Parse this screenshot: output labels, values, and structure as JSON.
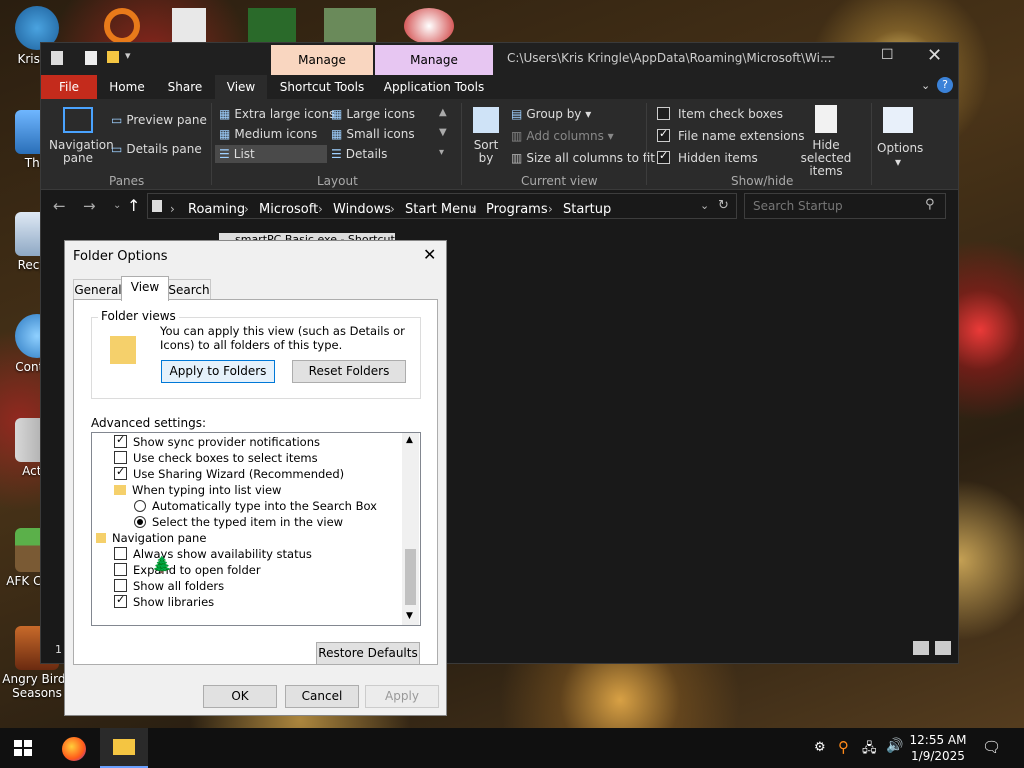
{
  "desktop": {
    "icons": [
      {
        "label": "Kris Kr"
      },
      {
        "label": "This"
      },
      {
        "label": "Recycl"
      },
      {
        "label": "Control"
      },
      {
        "label": "Activ"
      },
      {
        "label": "AFK Co Cli"
      },
      {
        "label": "Angry Birds Seasons"
      }
    ]
  },
  "explorer": {
    "title_path": "C:\\Users\\Kris Kringle\\AppData\\Roaming\\Microsoft\\Wi...",
    "context_tabs": [
      "Manage",
      "Manage"
    ],
    "tabs": [
      "File",
      "Home",
      "Share",
      "View",
      "Shortcut Tools",
      "Application Tools"
    ],
    "ribbon": {
      "navigation_pane": "Navigation pane",
      "preview_pane": "Preview pane",
      "details_pane": "Details pane",
      "panes_group": "Panes",
      "layouts": [
        "Extra large icons",
        "Large icons",
        "Medium icons",
        "Small icons",
        "List",
        "Details"
      ],
      "layout_group": "Layout",
      "sort_by": "Sort by",
      "group_by": "Group by",
      "add_columns": "Add columns",
      "size_all_columns": "Size all columns to fit",
      "current_view_group": "Current view",
      "item_check_boxes": "Item check boxes",
      "file_name_extensions": "File name extensions",
      "hidden_items": "Hidden items",
      "hide_selected": "Hide selected items",
      "show_hide_group": "Show/hide",
      "options": "Options"
    },
    "breadcrumbs": [
      "Roaming",
      "Microsoft",
      "Windows",
      "Start Menu",
      "Programs",
      "Startup"
    ],
    "search_placeholder": "Search Startup",
    "file_item": "smartPC Basic.exe - Shortcut",
    "status_count": "1"
  },
  "dialog": {
    "title": "Folder Options",
    "tabs": [
      "General",
      "View",
      "Search"
    ],
    "folder_views_label": "Folder views",
    "folder_views_text": "You can apply this view (such as Details or Icons) to all folders of this type.",
    "apply_to_folders": "Apply to Folders",
    "reset_folders": "Reset Folders",
    "advanced_label": "Advanced settings:",
    "items": [
      "Show sync provider notifications",
      "Use check boxes to select items",
      "Use Sharing Wizard (Recommended)",
      "When typing into list view",
      "Automatically type into the Search Box",
      "Select the typed item in the view",
      "Navigation pane",
      "Always show availability status",
      "Expand to open folder",
      "Show all folders",
      "Show libraries"
    ],
    "restore_defaults": "Restore Defaults",
    "ok": "OK",
    "cancel": "Cancel",
    "apply": "Apply"
  },
  "taskbar": {
    "time": "12:55 AM",
    "date": "1/9/2025"
  }
}
